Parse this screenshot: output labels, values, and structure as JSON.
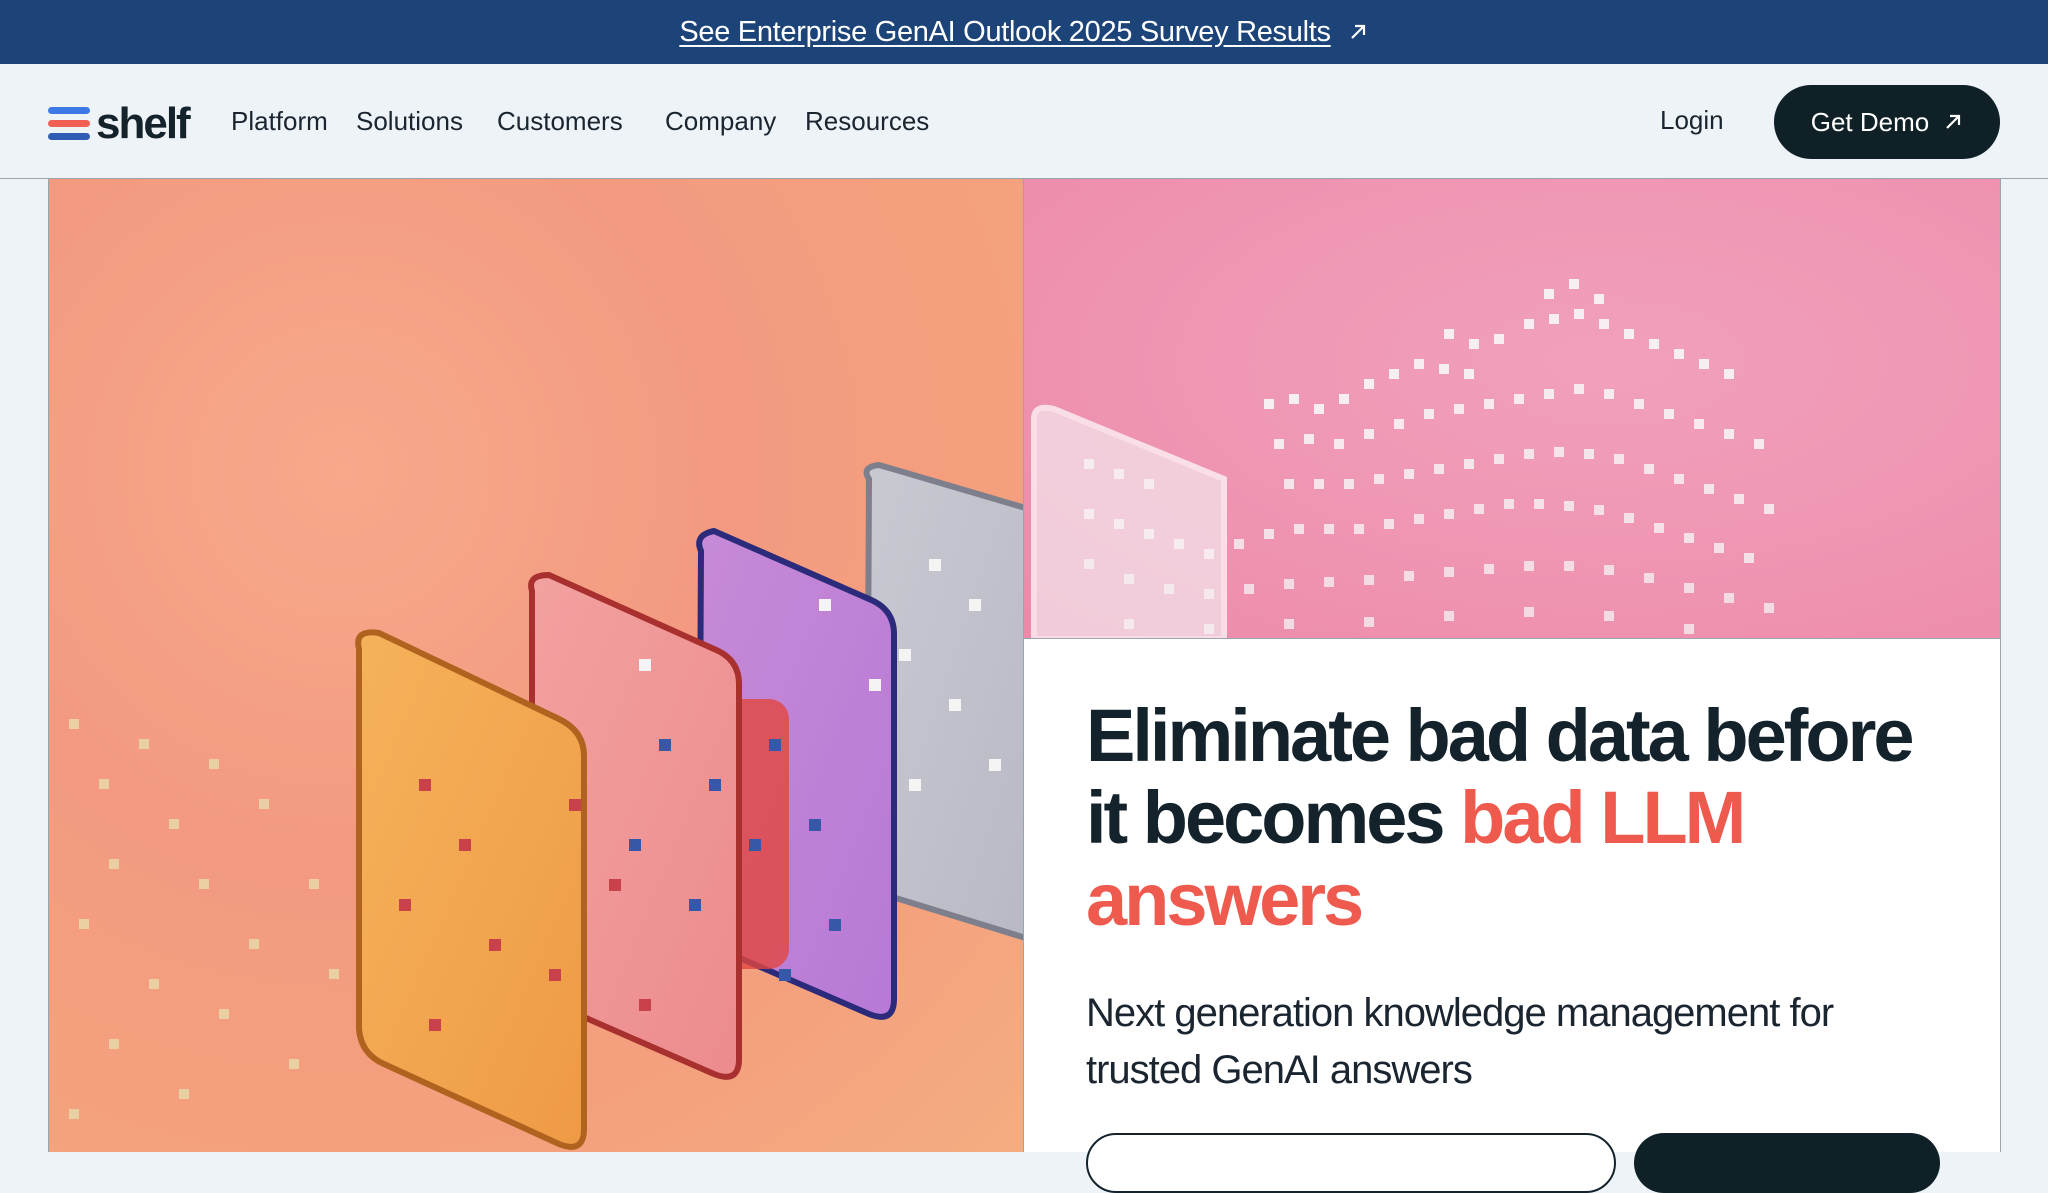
{
  "announcement": {
    "text": "See Enterprise GenAI Outlook 2025 Survey Results",
    "icon": "arrow-up-right-icon"
  },
  "nav": {
    "logo_text": "shelf",
    "menu": [
      "Platform",
      "Solutions",
      "Customers",
      "Company",
      "Resources"
    ],
    "login": "Login",
    "demo": "Get Demo",
    "demo_icon": "arrow-up-right-icon"
  },
  "hero": {
    "headline_main": "Eliminate bad data before it becomes ",
    "headline_accent": "bad LLM answers",
    "subhead": "Next generation knowledge management for trusted GenAI answers"
  },
  "colors": {
    "announcement_bg": "#1c4479",
    "accent": "#ef5a4e",
    "dark": "#0f2027",
    "page_bg": "#eef3f7"
  }
}
